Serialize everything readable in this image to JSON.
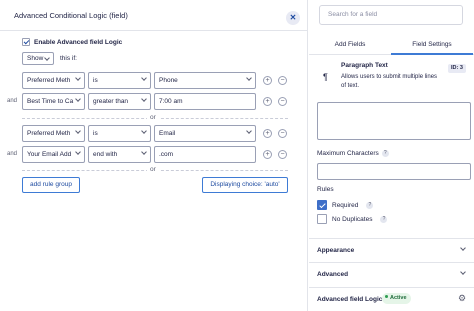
{
  "modal": {
    "title": "Advanced Conditional Logic (field)",
    "close_icon": "close-icon",
    "enable_label": "Enable Advanced field Logic",
    "enable_checked": true,
    "action_value": "Show",
    "this_if_label": "this if:",
    "groups": [
      {
        "rules": [
          {
            "and": "",
            "field": "Preferred Meth",
            "operator": "is",
            "value": "Phone",
            "value_is_select": true
          },
          {
            "and": "and",
            "field": "Best Time to Ca",
            "operator": "greater than",
            "value": "7:00 am",
            "value_is_select": false
          }
        ]
      },
      {
        "rules": [
          {
            "and": "",
            "field": "Preferred Meth",
            "operator": "is",
            "value": "Email",
            "value_is_select": true
          },
          {
            "and": "and",
            "field": "Your Email Add",
            "operator": "end with",
            "value": ".com",
            "value_is_select": false
          }
        ]
      }
    ],
    "or_label": "or",
    "add_group_label": "add rule group",
    "displaying_label": "Displaying choice: 'auto'",
    "plus_symbol": "+",
    "minus_symbol": "−"
  },
  "sidebar": {
    "search_placeholder": "Search for a field",
    "tabs": [
      "Add Fields",
      "Field Settings"
    ],
    "active_tab": 1,
    "field": {
      "icon": "paragraph-icon",
      "title": "Paragraph Text",
      "id_badge": "ID: 3",
      "description": "Allows users to submit multiple lines of text."
    },
    "max_chars_label": "Maximum Characters",
    "help_symbol": "?",
    "rules_label": "Rules",
    "rules": [
      {
        "label": "Required",
        "checked": true
      },
      {
        "label": "No Duplicates",
        "checked": false
      }
    ],
    "sections": [
      {
        "title": "Appearance"
      },
      {
        "title": "Advanced"
      }
    ],
    "logic_section": {
      "title": "Advanced field Logic",
      "badge": "Active"
    },
    "accent_color": "#3e7bd5"
  }
}
